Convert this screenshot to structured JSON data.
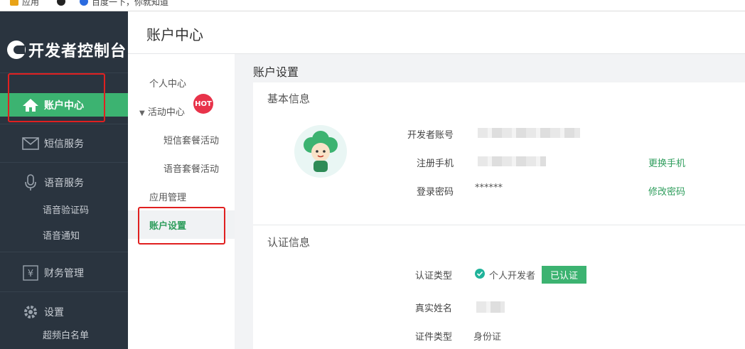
{
  "bookmarks": [
    {
      "label": "应用",
      "color": "#e8a317"
    },
    {
      "label": "",
      "color": "#222222"
    },
    {
      "label": "百度一下，你就知道",
      "color": "#2b6be0"
    }
  ],
  "sidebar": {
    "brand": "开发者控制台",
    "items": [
      {
        "label": "账户中心",
        "icon": "home-icon"
      },
      {
        "label": "短信服务",
        "icon": "mail-icon"
      },
      {
        "label": "语音服务",
        "icon": "microphone-icon"
      },
      {
        "label": "财务管理",
        "icon": "yen-icon"
      },
      {
        "label": "设置",
        "icon": "gear-icon"
      }
    ],
    "voice_sub": [
      "语音验证码",
      "语音通知"
    ],
    "settings_sub": [
      "超频白名单"
    ]
  },
  "header": {
    "title": "账户中心"
  },
  "subnav": {
    "personal": "个人中心",
    "activity": "活动中心",
    "hot": "HOT",
    "sms_pkg": "短信套餐活动",
    "voice_pkg": "语音套餐活动",
    "app_mgmt": "应用管理",
    "account_settings": "账户设置"
  },
  "main": {
    "page_title": "账户设置",
    "basic": {
      "title": "基本信息",
      "dev_account_label": "开发者账号",
      "phone_label": "注册手机",
      "password_label": "登录密码",
      "password_value": "******",
      "change_phone": "更换手机",
      "change_password": "修改密码"
    },
    "auth": {
      "title": "认证信息",
      "type_label": "认证类型",
      "type_value": "个人开发者",
      "verified": "已认证",
      "name_label": "真实姓名",
      "id_type_label": "证件类型",
      "id_type_value": "身份证"
    }
  },
  "colors": {
    "accent": "#3cb371",
    "sidebar_bg": "#2a343f",
    "link": "#2e9d5c",
    "annotation_red": "#e02020"
  }
}
